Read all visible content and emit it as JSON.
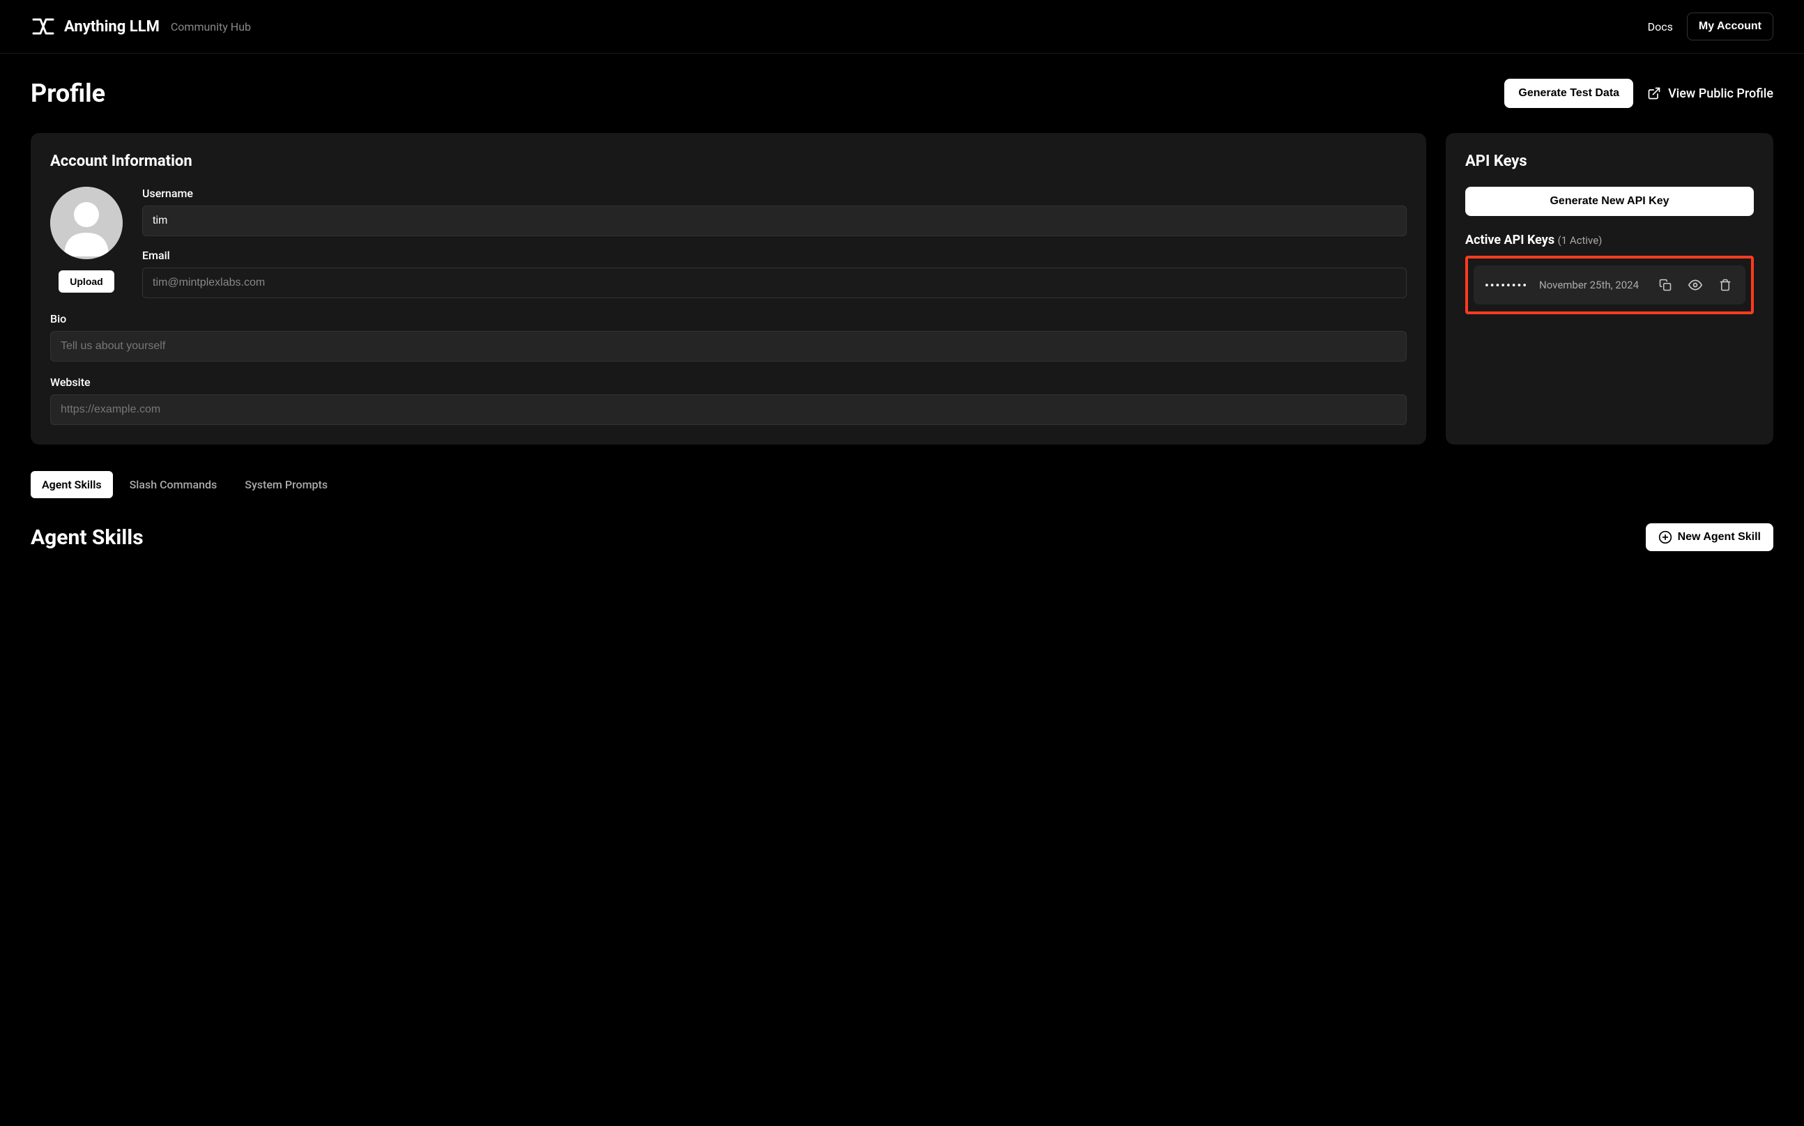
{
  "header": {
    "brand": "Anything LLM",
    "subtitle": "Community Hub",
    "docs_link": "Docs",
    "account_button": "My Account"
  },
  "page": {
    "title": "Profile",
    "generate_test_button": "Generate Test Data",
    "view_public_link": "View Public Profile"
  },
  "account": {
    "card_title": "Account Information",
    "upload_button": "Upload",
    "username_label": "Username",
    "username_value": "tim",
    "email_label": "Email",
    "email_value": "tim@mintplexlabs.com",
    "bio_label": "Bio",
    "bio_placeholder": "Tell us about yourself",
    "bio_value": "",
    "website_label": "Website",
    "website_placeholder": "https://example.com",
    "website_value": ""
  },
  "api": {
    "card_title": "API Keys",
    "generate_button": "Generate New API Key",
    "active_title": "Active API Keys",
    "active_count": "(1 Active)",
    "key_masked": "••••••••",
    "key_date": "November 25th, 2024"
  },
  "tabs": [
    {
      "label": "Agent Skills",
      "active": true
    },
    {
      "label": "Slash Commands",
      "active": false
    },
    {
      "label": "System Prompts",
      "active": false
    }
  ],
  "skills": {
    "title": "Agent Skills",
    "new_button": "New Agent Skill"
  }
}
